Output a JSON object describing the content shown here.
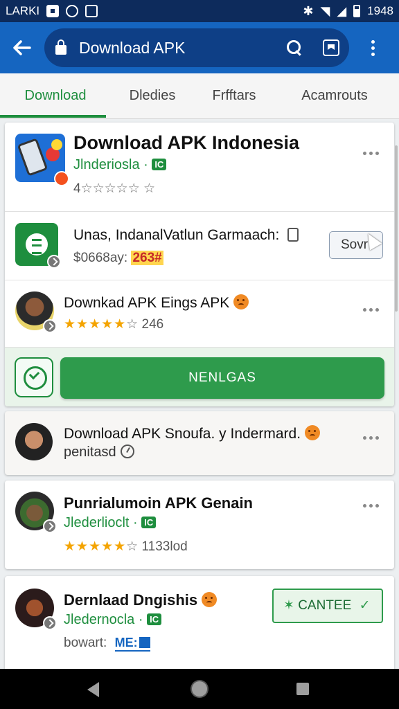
{
  "status_bar": {
    "carrier": "LARKI",
    "time": "1948"
  },
  "browser": {
    "url_text": "Download APK"
  },
  "tabs": [
    "Download",
    "Dledies",
    "Frfftars",
    "Acamrouts"
  ],
  "items": [
    {
      "title": "Download APK Indonesia",
      "developer": "Jlnderiosla ·",
      "badge": "IC",
      "rating_prefix": "4",
      "rating_stars": "☆☆☆☆☆ ☆"
    },
    {
      "title": "Unas, IndanalVatlun Garmaach:",
      "price_label": "$0668ay:",
      "price_value": "263#",
      "button_label": "Sovr"
    },
    {
      "title": "Downkad APK Eings APK",
      "stars_filled": "★★★★★",
      "stars_empty": "☆",
      "rating_count": "246"
    },
    {
      "button_label": "NENLGAS"
    },
    {
      "title": "Download APK Snoufa. y Indermard.",
      "subtitle": "penitasd"
    },
    {
      "title": "Punrialumoin APK Genain",
      "developer": "Jlederlioclt ·",
      "badge": "IC",
      "stars_filled": "★★★★★",
      "stars_empty": "☆",
      "rating_count": "1133lod"
    },
    {
      "title": "Dernlaad Dngishis",
      "developer": "Jledernocla ·",
      "badge": "IC",
      "meta_label": "bowart:",
      "meta_brand": "ME:",
      "button_label": "CANTEE"
    }
  ],
  "colors": {
    "primary": "#1565c0",
    "status_bar": "#0d2b5c",
    "accent_green": "#1e8e3e",
    "star_gold": "#f4a400"
  }
}
